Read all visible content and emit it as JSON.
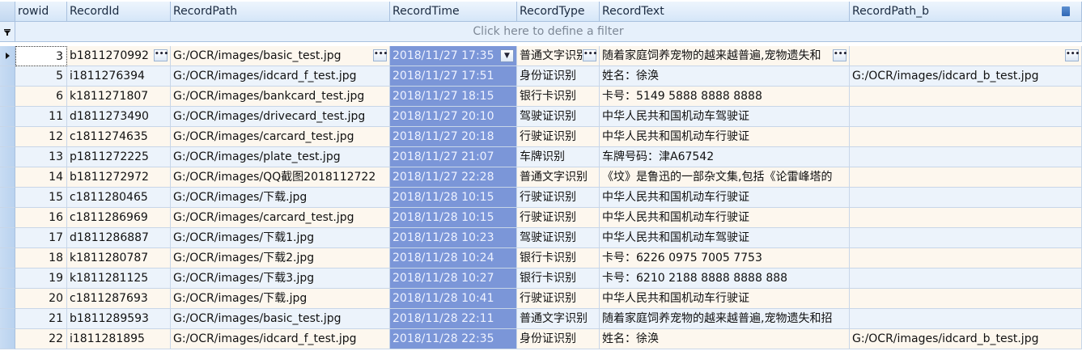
{
  "columns": {
    "rowid": "rowid",
    "recordid": "RecordId",
    "recordpath": "RecordPath",
    "recordtime": "RecordTime",
    "recordtype": "RecordType",
    "recordtext": "RecordText",
    "recordpath_b": "RecordPath_b"
  },
  "filter": {
    "placeholder": "Click here to define a filter"
  },
  "icons": {
    "current_row": "row-indicator-arrow-icon",
    "filter": "filter-funnel-icon",
    "ellipsis": "ellipsis-button-icon",
    "dropdown": "dropdown-arrow-icon"
  },
  "colors": {
    "header_bg": "#d5e6f8",
    "filter_bg": "#e6f0fb",
    "even_row_bg": "#fdf7ee",
    "odd_row_bg": "#ecf3fb",
    "time_column_bg": "#7b96d8",
    "time_text": "#eef2ff",
    "sort_accent": "#2f67b5"
  },
  "rows": [
    {
      "rowid": "3",
      "recordid": "b1811270992",
      "recordpath": "G:/OCR/images/basic_test.jpg",
      "recordtime": "2018/11/27 17:35",
      "recordtype": "普通文字识别",
      "recordtext": "随着家庭饲养宠物的越来越普遍,宠物遗失和",
      "recordpath_b": ""
    },
    {
      "rowid": "5",
      "recordid": "i1811276394",
      "recordpath": "G:/OCR/images/idcard_f_test.jpg",
      "recordtime": "2018/11/27 17:51",
      "recordtype": "身份证识别",
      "recordtext": "姓名：徐涣",
      "recordpath_b": "G:/OCR/images/idcard_b_test.jpg"
    },
    {
      "rowid": "6",
      "recordid": "k1811271807",
      "recordpath": "G:/OCR/images/bankcard_test.jpg",
      "recordtime": "2018/11/27 18:15",
      "recordtype": "银行卡识别",
      "recordtext": "卡号：5149 5888 8888 8888",
      "recordpath_b": ""
    },
    {
      "rowid": "11",
      "recordid": "d1811273490",
      "recordpath": "G:/OCR/images/drivecard_test.jpg",
      "recordtime": "2018/11/27 20:10",
      "recordtype": "驾驶证识别",
      "recordtext": "中华人民共和国机动车驾驶证",
      "recordpath_b": ""
    },
    {
      "rowid": "12",
      "recordid": "c1811274635",
      "recordpath": "G:/OCR/images/carcard_test.jpg",
      "recordtime": "2018/11/27 20:18",
      "recordtype": "行驶证识别",
      "recordtext": "中华人民共和国机动车行驶证",
      "recordpath_b": ""
    },
    {
      "rowid": "13",
      "recordid": "p1811272225",
      "recordpath": "G:/OCR/images/plate_test.jpg",
      "recordtime": "2018/11/27 21:07",
      "recordtype": "车牌识别",
      "recordtext": "车牌号码：津A67542",
      "recordpath_b": ""
    },
    {
      "rowid": "14",
      "recordid": "b1811272972",
      "recordpath": "G:/OCR/images/QQ截图2018112722",
      "recordtime": "2018/11/27 22:28",
      "recordtype": "普通文字识别",
      "recordtext": "《坟》是鲁迅的一部杂文集,包括《论雷峰塔的",
      "recordpath_b": ""
    },
    {
      "rowid": "15",
      "recordid": "c1811280465",
      "recordpath": "G:/OCR/images/下载.jpg",
      "recordtime": "2018/11/28 10:15",
      "recordtype": "行驶证识别",
      "recordtext": "中华人民共和国机动车行驶证",
      "recordpath_b": ""
    },
    {
      "rowid": "16",
      "recordid": "c1811286969",
      "recordpath": "G:/OCR/images/carcard_test.jpg",
      "recordtime": "2018/11/28 10:15",
      "recordtype": "行驶证识别",
      "recordtext": "中华人民共和国机动车行驶证",
      "recordpath_b": ""
    },
    {
      "rowid": "17",
      "recordid": "d1811286887",
      "recordpath": "G:/OCR/images/下载1.jpg",
      "recordtime": "2018/11/28 10:23",
      "recordtype": "驾驶证识别",
      "recordtext": "中华人民共和国机动车驾驶证",
      "recordpath_b": ""
    },
    {
      "rowid": "18",
      "recordid": "k1811280787",
      "recordpath": "G:/OCR/images/下载2.jpg",
      "recordtime": "2018/11/28 10:24",
      "recordtype": "银行卡识别",
      "recordtext": "卡号：6226 0975 7005 7753",
      "recordpath_b": ""
    },
    {
      "rowid": "19",
      "recordid": "k1811281125",
      "recordpath": "G:/OCR/images/下载3.jpg",
      "recordtime": "2018/11/28 10:27",
      "recordtype": "银行卡识别",
      "recordtext": "卡号：6210 2188 8888 8888 888",
      "recordpath_b": ""
    },
    {
      "rowid": "20",
      "recordid": "c1811287693",
      "recordpath": "G:/OCR/images/下载.jpg",
      "recordtime": "2018/11/28 10:41",
      "recordtype": "行驶证识别",
      "recordtext": "中华人民共和国机动车行驶证",
      "recordpath_b": ""
    },
    {
      "rowid": "21",
      "recordid": "b1811289593",
      "recordpath": "G:/OCR/images/basic_test.jpg",
      "recordtime": "2018/11/28 22:11",
      "recordtype": "普通文字识别",
      "recordtext": "随着家庭饲养宠物的越来越普遍,宠物遗失和招",
      "recordpath_b": ""
    },
    {
      "rowid": "22",
      "recordid": "i1811281895",
      "recordpath": "G:/OCR/images/idcard_f_test.jpg",
      "recordtime": "2018/11/28 22:35",
      "recordtype": "身份证识别",
      "recordtext": "姓名：徐涣",
      "recordpath_b": "G:/OCR/images/idcard_b_test.jpg"
    }
  ]
}
